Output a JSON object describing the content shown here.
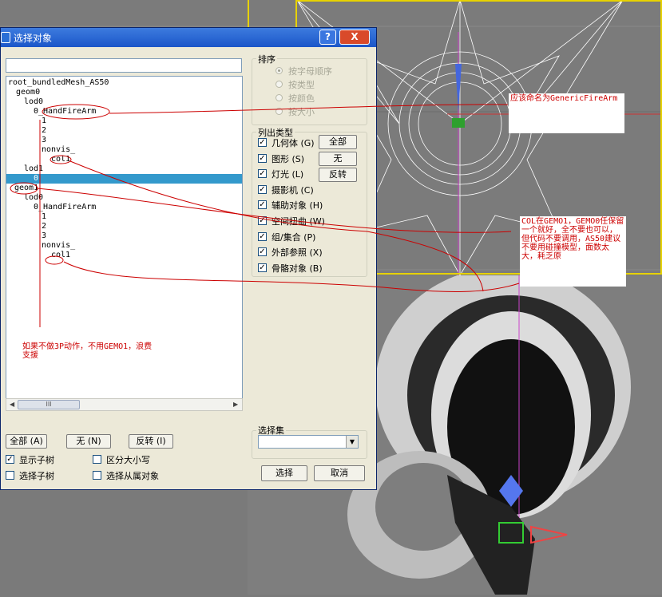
{
  "dialog": {
    "title": "选择对象",
    "help_label": "?",
    "close_label": "X"
  },
  "tree": {
    "nodes": [
      {
        "label": "root_bundledMesh_AS50",
        "selected": false
      },
      {
        "label": "geom0",
        "selected": false
      },
      {
        "label": "lod0",
        "selected": false
      },
      {
        "label": "0_HandFireArm",
        "selected": false
      },
      {
        "label": "1",
        "selected": false
      },
      {
        "label": "2",
        "selected": false
      },
      {
        "label": "3",
        "selected": false
      },
      {
        "label": "nonvis_",
        "selected": false
      },
      {
        "label": "col1",
        "selected": false
      },
      {
        "label": "lod1",
        "selected": false
      },
      {
        "label": "0",
        "selected": true
      },
      {
        "label": "geom1",
        "selected": false
      },
      {
        "label": "lod0",
        "selected": false
      },
      {
        "label": "0_HandFireArm",
        "selected": false
      },
      {
        "label": "1",
        "selected": false
      },
      {
        "label": "2",
        "selected": false
      },
      {
        "label": "3",
        "selected": false
      },
      {
        "label": "nonvis_",
        "selected": false
      },
      {
        "label": "col1",
        "selected": false
      }
    ],
    "scroll_thumb": "III"
  },
  "sort_group": {
    "title": "排序",
    "options": [
      "按字母顺序",
      "按类型",
      "按颜色",
      "按大小"
    ]
  },
  "list_types": {
    "title": "列出类型",
    "items": [
      "几何体 (G)",
      "图形 (S)",
      "灯光 (L)",
      "摄影机 (C)",
      "辅助对象 (H)",
      "空间扭曲 (W)",
      "组/集合 (P)",
      "外部参照 (X)",
      "骨骼对象 (B)"
    ],
    "buttons": [
      "全部",
      "无",
      "反转"
    ]
  },
  "bottom_buttons": [
    "全部 (A)",
    "无 (N)",
    "反转 (I)"
  ],
  "checkboxes": [
    {
      "label": "显示子树",
      "checked": true
    },
    {
      "label": "区分大小写",
      "checked": false
    },
    {
      "label": "选择子树",
      "checked": false
    },
    {
      "label": "选择从属对象",
      "checked": false
    }
  ],
  "selection_set": {
    "title": "选择集",
    "value": ""
  },
  "actions": {
    "select_label": "选择",
    "cancel_label": "取消"
  },
  "annotations": {
    "note1": "应该命名为GenericFireArm",
    "note2": "COL在GEMO1，GEMO0任保留一个就好，全不要也可以，但代码不要调用，AS50建议不要用碰撞模型，面数太大，耗乏原",
    "note3": "如果不做3P动作，不用GEMO1，浪费支援"
  },
  "colors": {
    "annotation": "#cc0000",
    "selection": "#3399cc",
    "title_bar": "#1b56c9",
    "viewport_border": "#e7d200"
  }
}
